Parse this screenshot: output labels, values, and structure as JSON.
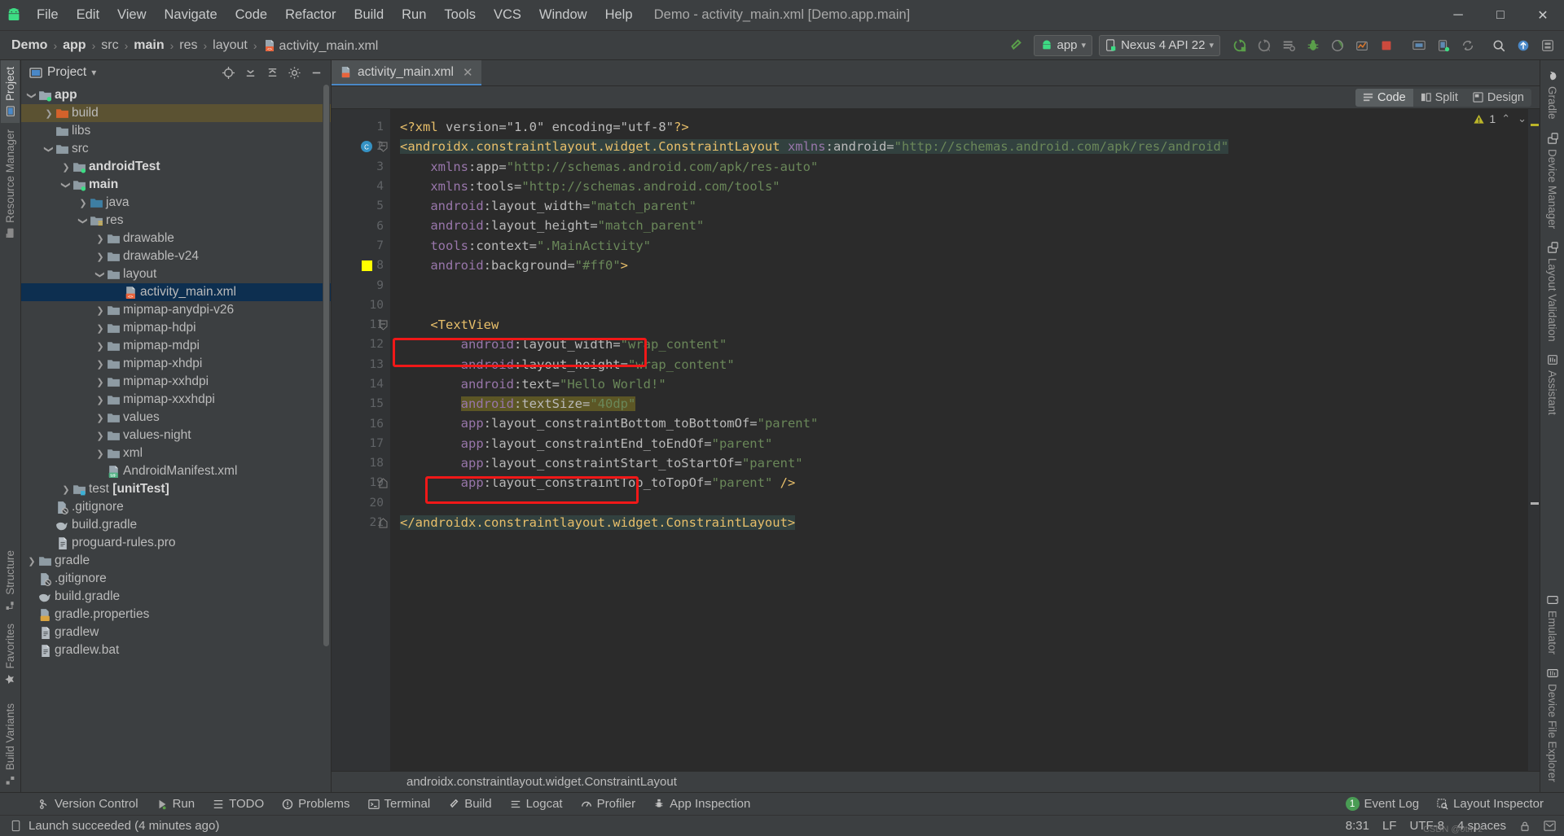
{
  "window": {
    "title": "Demo - activity_main.xml [Demo.app.main]",
    "logo_icon": "android-logo-icon",
    "minimize_label": "─",
    "maximize_label": "□",
    "close_label": "✕"
  },
  "menubar": {
    "items": [
      {
        "label": "File",
        "mnemonic": "F"
      },
      {
        "label": "Edit",
        "mnemonic": "E"
      },
      {
        "label": "View",
        "mnemonic": "V"
      },
      {
        "label": "Navigate",
        "mnemonic": "N"
      },
      {
        "label": "Code",
        "mnemonic": "C"
      },
      {
        "label": "Refactor",
        "mnemonic": "R"
      },
      {
        "label": "Build",
        "mnemonic": "B"
      },
      {
        "label": "Run",
        "mnemonic": "u"
      },
      {
        "label": "Tools",
        "mnemonic": "T"
      },
      {
        "label": "VCS",
        "mnemonic": "S"
      },
      {
        "label": "Window",
        "mnemonic": "W"
      },
      {
        "label": "Help",
        "mnemonic": "H"
      }
    ]
  },
  "breadcrumbs": {
    "items": [
      {
        "label": "Demo",
        "bold": true
      },
      {
        "label": "app",
        "bold": true
      },
      {
        "label": "src",
        "bold": false
      },
      {
        "label": "main",
        "bold": true
      },
      {
        "label": "res",
        "bold": false
      },
      {
        "label": "layout",
        "bold": false
      },
      {
        "label": "activity_main.xml",
        "bold": false,
        "icon": "xml-layout-file-icon"
      }
    ],
    "separator": "›"
  },
  "toolbar": {
    "build_hammer_icon": "hammer-icon",
    "run_config": {
      "label": "app",
      "icon": "android-app-icon",
      "chevron": "▾"
    },
    "device_target": {
      "label": "Nexus 4 API 22",
      "icon": "device-phone-icon",
      "chevron": "▾"
    },
    "buttons": [
      {
        "name": "run-button",
        "icon": "run-play-icon"
      },
      {
        "name": "apply-changes-button",
        "icon": "apply-changes-icon"
      },
      {
        "name": "debug-attach-button",
        "icon": "attach-debugger-icon"
      },
      {
        "name": "debug-button",
        "icon": "debug-bug-icon"
      },
      {
        "name": "run-coverage-button",
        "icon": "coverage-icon"
      },
      {
        "name": "profile-button",
        "icon": "profiler-icon"
      },
      {
        "name": "stop-button",
        "icon": "stop-square-icon"
      },
      {
        "name": "avd-manager-button",
        "icon": "avd-manager-icon"
      },
      {
        "name": "sdk-manager-button",
        "icon": "sdk-manager-icon"
      },
      {
        "name": "sync-gradle-button",
        "icon": "gradle-sync-icon"
      },
      {
        "name": "search-everywhere-button",
        "icon": "search-icon"
      },
      {
        "name": "vcs-update-button",
        "icon": "vcs-update-icon"
      },
      {
        "name": "settings-button",
        "icon": "gear-icon"
      }
    ]
  },
  "left_tool_strip": {
    "top": [
      {
        "label": "Project",
        "icon": "project-folder-icon",
        "active": true
      },
      {
        "label": "Resource Manager",
        "icon": "resource-manager-icon",
        "active": false
      }
    ],
    "bottom": [
      {
        "label": "Structure",
        "icon": "structure-icon",
        "active": false
      },
      {
        "label": "Favorites",
        "icon": "star-icon",
        "active": false
      },
      {
        "label": "Build Variants",
        "icon": "build-variants-icon",
        "active": false
      }
    ]
  },
  "right_tool_strip": {
    "items": [
      {
        "label": "Gradle",
        "icon": "gradle-elephant-icon"
      },
      {
        "label": "Device Manager",
        "icon": "device-manager-icon"
      },
      {
        "label": "Layout Validation",
        "icon": "layout-validation-icon"
      },
      {
        "label": "Assistant",
        "icon": "assistant-icon"
      },
      {
        "label": "Emulator",
        "icon": "emulator-icon"
      },
      {
        "label": "Device File Explorer",
        "icon": "device-file-explorer-icon"
      }
    ]
  },
  "project_panel": {
    "title": "Project",
    "title_chevron": "▾",
    "actions": [
      {
        "name": "select-opened-file-button",
        "icon": "target-crosshair-icon"
      },
      {
        "name": "expand-all-button",
        "icon": "expand-all-icon"
      },
      {
        "name": "collapse-all-button",
        "icon": "collapse-all-icon"
      },
      {
        "name": "settings-button",
        "icon": "gear-icon"
      },
      {
        "name": "hide-button",
        "icon": "minimize-icon"
      }
    ],
    "tree": [
      {
        "label": "app",
        "indent": 1,
        "arrow": "down",
        "icon": "module-folder-icon",
        "bold": true,
        "state": "none"
      },
      {
        "label": "build",
        "indent": 2,
        "arrow": "right",
        "icon": "build-folder-icon",
        "bold": false,
        "state": "build-selected"
      },
      {
        "label": "libs",
        "indent": 2,
        "arrow": "none",
        "icon": "folder-icon",
        "bold": false,
        "state": "none"
      },
      {
        "label": "src",
        "indent": 2,
        "arrow": "down",
        "icon": "folder-icon",
        "bold": false,
        "state": "none"
      },
      {
        "label": "androidTest",
        "indent": 3,
        "arrow": "right",
        "icon": "source-folder-icon",
        "bold": true,
        "state": "none"
      },
      {
        "label": "main",
        "indent": 3,
        "arrow": "down",
        "icon": "source-folder-icon",
        "bold": true,
        "state": "none"
      },
      {
        "label": "java",
        "indent": 4,
        "arrow": "right",
        "icon": "java-folder-icon",
        "bold": false,
        "state": "none"
      },
      {
        "label": "res",
        "indent": 4,
        "arrow": "down",
        "icon": "res-folder-icon",
        "bold": false,
        "state": "none"
      },
      {
        "label": "drawable",
        "indent": 5,
        "arrow": "right",
        "icon": "folder-icon",
        "bold": false,
        "state": "none"
      },
      {
        "label": "drawable-v24",
        "indent": 5,
        "arrow": "right",
        "icon": "folder-icon",
        "bold": false,
        "state": "none"
      },
      {
        "label": "layout",
        "indent": 5,
        "arrow": "down",
        "icon": "folder-icon",
        "bold": false,
        "state": "none"
      },
      {
        "label": "activity_main.xml",
        "indent": 6,
        "arrow": "none",
        "icon": "xml-layout-file-icon",
        "bold": false,
        "state": "file-selected"
      },
      {
        "label": "mipmap-anydpi-v26",
        "indent": 5,
        "arrow": "right",
        "icon": "folder-icon",
        "bold": false,
        "state": "none"
      },
      {
        "label": "mipmap-hdpi",
        "indent": 5,
        "arrow": "right",
        "icon": "folder-icon",
        "bold": false,
        "state": "none"
      },
      {
        "label": "mipmap-mdpi",
        "indent": 5,
        "arrow": "right",
        "icon": "folder-icon",
        "bold": false,
        "state": "none"
      },
      {
        "label": "mipmap-xhdpi",
        "indent": 5,
        "arrow": "right",
        "icon": "folder-icon",
        "bold": false,
        "state": "none"
      },
      {
        "label": "mipmap-xxhdpi",
        "indent": 5,
        "arrow": "right",
        "icon": "folder-icon",
        "bold": false,
        "state": "none"
      },
      {
        "label": "mipmap-xxxhdpi",
        "indent": 5,
        "arrow": "right",
        "icon": "folder-icon",
        "bold": false,
        "state": "none"
      },
      {
        "label": "values",
        "indent": 5,
        "arrow": "right",
        "icon": "folder-icon",
        "bold": false,
        "state": "none"
      },
      {
        "label": "values-night",
        "indent": 5,
        "arrow": "right",
        "icon": "folder-icon",
        "bold": false,
        "state": "none"
      },
      {
        "label": "xml",
        "indent": 5,
        "arrow": "right",
        "icon": "folder-icon",
        "bold": false,
        "state": "none"
      },
      {
        "label": "AndroidManifest.xml",
        "indent": 5,
        "arrow": "none",
        "icon": "manifest-file-icon",
        "bold": false,
        "state": "none"
      },
      {
        "label": "test [unitTest]",
        "indent": 3,
        "arrow": "right",
        "icon": "test-folder-icon",
        "bold": false,
        "state": "none",
        "bold_part": "[unitTest]"
      },
      {
        "label": ".gitignore",
        "indent": 2,
        "arrow": "none",
        "icon": "gitignore-file-icon",
        "bold": false,
        "state": "none"
      },
      {
        "label": "build.gradle",
        "indent": 2,
        "arrow": "none",
        "icon": "gradle-file-icon",
        "bold": false,
        "state": "none"
      },
      {
        "label": "proguard-rules.pro",
        "indent": 2,
        "arrow": "none",
        "icon": "text-file-icon",
        "bold": false,
        "state": "none"
      },
      {
        "label": "gradle",
        "indent": 1,
        "arrow": "right",
        "icon": "folder-icon",
        "bold": false,
        "state": "none"
      },
      {
        "label": ".gitignore",
        "indent": 1,
        "arrow": "none",
        "icon": "gitignore-file-icon",
        "bold": false,
        "state": "none"
      },
      {
        "label": "build.gradle",
        "indent": 1,
        "arrow": "none",
        "icon": "gradle-file-icon",
        "bold": false,
        "state": "none"
      },
      {
        "label": "gradle.properties",
        "indent": 1,
        "arrow": "none",
        "icon": "properties-file-icon",
        "bold": false,
        "state": "none"
      },
      {
        "label": "gradlew",
        "indent": 1,
        "arrow": "none",
        "icon": "text-file-icon",
        "bold": false,
        "state": "none"
      },
      {
        "label": "gradlew.bat",
        "indent": 1,
        "arrow": "none",
        "icon": "text-file-icon",
        "bold": false,
        "state": "none"
      }
    ]
  },
  "editor": {
    "tab": {
      "label": "activity_main.xml",
      "icon": "xml-layout-file-icon",
      "close": "✕"
    },
    "mode_toggle": {
      "options": [
        {
          "label": "Code",
          "icon": "code-view-icon",
          "active": true
        },
        {
          "label": "Split",
          "icon": "split-view-icon",
          "active": false
        },
        {
          "label": "Design",
          "icon": "design-view-icon",
          "active": false
        }
      ]
    },
    "inspection": {
      "warning_count": "1",
      "up_chevron": "⌃",
      "down_chevron": "⌄"
    },
    "bottom_breadcrumb": "androidx.constraintlayout.widget.ConstraintLayout",
    "lines": [
      {
        "n": 1,
        "mark": "none",
        "fold": "none",
        "text": "<?xml version=\"1.0\" encoding=\"utf-8\"?>"
      },
      {
        "n": 2,
        "mark": "class",
        "fold": "open",
        "text": "<androidx.constraintlayout.widget.ConstraintLayout xmlns:android=\"http://schemas.android.com/apk/res/android\""
      },
      {
        "n": 3,
        "mark": "none",
        "fold": "none",
        "text": "    xmlns:app=\"http://schemas.android.com/apk/res-auto\""
      },
      {
        "n": 4,
        "mark": "none",
        "fold": "none",
        "text": "    xmlns:tools=\"http://schemas.android.com/tools\""
      },
      {
        "n": 5,
        "mark": "none",
        "fold": "none",
        "text": "    android:layout_width=\"match_parent\""
      },
      {
        "n": 6,
        "mark": "none",
        "fold": "none",
        "text": "    android:layout_height=\"match_parent\""
      },
      {
        "n": 7,
        "mark": "none",
        "fold": "none",
        "text": "    tools:context=\".MainActivity\""
      },
      {
        "n": 8,
        "mark": "color",
        "fold": "none",
        "text": "    android:background=\"#ff0\">"
      },
      {
        "n": 9,
        "mark": "none",
        "fold": "none",
        "text": ""
      },
      {
        "n": 10,
        "mark": "none",
        "fold": "none",
        "text": ""
      },
      {
        "n": 11,
        "mark": "none",
        "fold": "open",
        "text": "    <TextView"
      },
      {
        "n": 12,
        "mark": "none",
        "fold": "none",
        "text": "        android:layout_width=\"wrap_content\""
      },
      {
        "n": 13,
        "mark": "none",
        "fold": "none",
        "text": "        android:layout_height=\"wrap_content\""
      },
      {
        "n": 14,
        "mark": "none",
        "fold": "none",
        "text": "        android:text=\"Hello World!\""
      },
      {
        "n": 15,
        "mark": "none",
        "fold": "none",
        "text": "        android:textSize=\"40dp\""
      },
      {
        "n": 16,
        "mark": "none",
        "fold": "none",
        "text": "        app:layout_constraintBottom_toBottomOf=\"parent\""
      },
      {
        "n": 17,
        "mark": "none",
        "fold": "none",
        "text": "        app:layout_constraintEnd_toEndOf=\"parent\""
      },
      {
        "n": 18,
        "mark": "none",
        "fold": "none",
        "text": "        app:layout_constraintStart_toStartOf=\"parent\""
      },
      {
        "n": 19,
        "mark": "none",
        "fold": "close",
        "text": "        app:layout_constraintTop_toTopOf=\"parent\" />"
      },
      {
        "n": 20,
        "mark": "none",
        "fold": "none",
        "text": ""
      },
      {
        "n": 21,
        "mark": "none",
        "fold": "close",
        "text": "</androidx.constraintlayout.widget.ConstraintLayout>"
      }
    ],
    "annotations": [
      {
        "name": "background-attribute-highlight",
        "line": 8,
        "label": "android:background=\"#ff0\">"
      },
      {
        "name": "textsize-attribute-highlight",
        "line": 15,
        "label": "android:textSize=\"40dp\""
      }
    ]
  },
  "bottom_tool_windows": {
    "items": [
      {
        "label": "Version Control",
        "icon": "version-control-icon"
      },
      {
        "label": "Run",
        "icon": "run-play-icon"
      },
      {
        "label": "TODO",
        "icon": "todo-list-icon"
      },
      {
        "label": "Problems",
        "icon": "problems-icon"
      },
      {
        "label": "Terminal",
        "icon": "terminal-icon"
      },
      {
        "label": "Build",
        "icon": "hammer-icon"
      },
      {
        "label": "Logcat",
        "icon": "logcat-icon"
      },
      {
        "label": "Profiler",
        "icon": "profiler-icon"
      },
      {
        "label": "App Inspection",
        "icon": "app-inspection-icon"
      }
    ],
    "right_items": [
      {
        "label": "Event Log",
        "icon": "event-log-icon",
        "badge": "1"
      },
      {
        "label": "Layout Inspector",
        "icon": "layout-inspector-icon"
      }
    ]
  },
  "statusbar": {
    "message": "Launch succeeded (4 minutes ago)",
    "message_icon": "device-small-icon",
    "caret_position": "8:31",
    "line_separator": "LF",
    "encoding": "UTF-8",
    "indent": "4 spaces",
    "lock_icon": "lock-icon",
    "notification_icon": "notifications-icon",
    "watermark": "CSDN @0tm-z"
  },
  "colors": {
    "accent_blue": "#4a88c7",
    "annotation_red": "#f01818",
    "selection_olive": "#5c5625",
    "tree_select_blue": "#0d2f50",
    "tree_build_olive": "#5b5232",
    "green": "#499c54",
    "warning_yellow": "#bbb529",
    "bg_panel": "#3c3f41",
    "bg_editor": "#2b2b2b"
  }
}
